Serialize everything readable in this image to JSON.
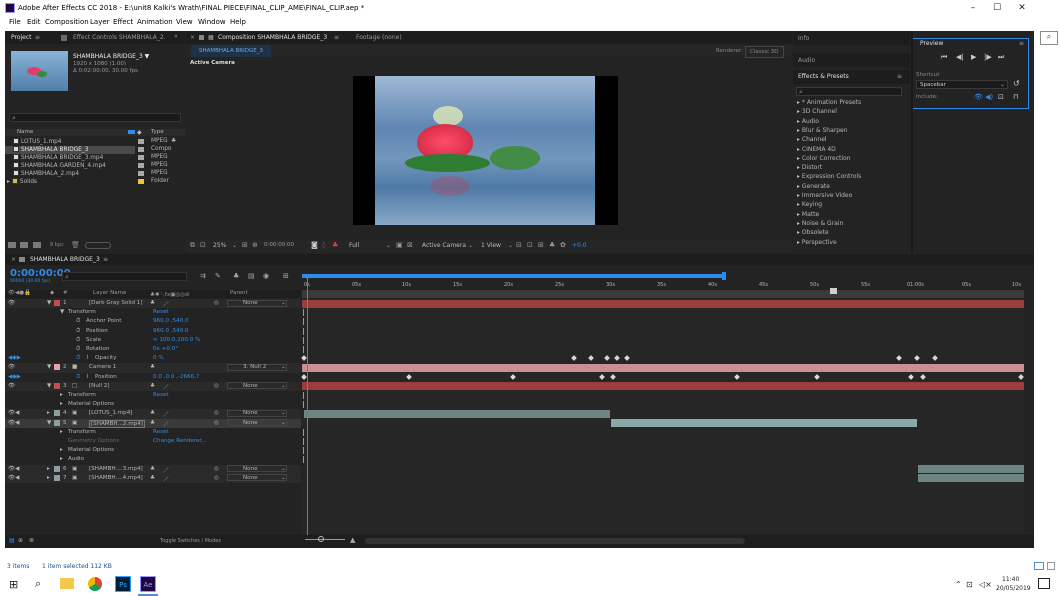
{
  "window": {
    "title": "Adobe After Effects CC 2018 - E:\\unit8 Kalki's Wrath\\FINAL PIECE\\FINAL_CLIP_AME\\FINAL_CLIP.aep *",
    "min": "–",
    "max": "☐",
    "close": "✕"
  },
  "menu": [
    "File",
    "Edit",
    "Composition",
    "Layer",
    "Effect",
    "Animation",
    "View",
    "Window",
    "Help"
  ],
  "project": {
    "tab": "Project",
    "tab_menu": "≡",
    "effect_tab": "Effect Controls SHAMBHALA_2.",
    "more": "»",
    "thumb_name": "SHAMBHALA BRIDGE_3 ▼",
    "thumb_res": "1920 x 1080 (1.00)",
    "thumb_dur": "Δ 0:02:00:00, 30.00 fps",
    "search_icon": "⌕",
    "col_name": "Name",
    "col_type": "Type",
    "items": [
      {
        "name": "LOTUS_1.mp4",
        "type": "MPEG",
        "color": "#a8a8a8",
        "selected": false
      },
      {
        "name": "SHAMBHALA BRIDGE_3",
        "type": "Compo",
        "color": "#a8a8a8",
        "selected": true
      },
      {
        "name": "SHAMBHALA BRIDGE_3.mp4",
        "type": "MPEG",
        "color": "#a8a8a8",
        "selected": false
      },
      {
        "name": "SHAMBHALA GARDEN_4.mp4",
        "type": "MPEG",
        "color": "#a8a8a8",
        "selected": false
      },
      {
        "name": "SHAMBHALA_2.mp4",
        "type": "MPEG",
        "color": "#a8a8a8",
        "selected": false
      },
      {
        "name": "Solids",
        "type": "Folder",
        "color": "#e8c83a",
        "selected": false
      }
    ],
    "bpc": "8 bpc"
  },
  "comp": {
    "tab": "Composition SHAMBHALA BRIDGE_3",
    "tab_menu": "≡",
    "footage": "Footage (none)",
    "subtab": "SHAMBHALA BRIDGE_3",
    "renderer_label": "Renderer:",
    "renderer": "Classic 3D",
    "active_camera": "Active Camera",
    "zoom": "25%",
    "timecode": "0:00:00:00",
    "resolution": "Full",
    "view": "Active Camera",
    "views": "1 View",
    "exposure": "+0.0"
  },
  "right": {
    "info": "Info",
    "audio": "Audio",
    "effects_title": "Effects & Presets",
    "effects_menu": "≡",
    "effects_search": "⌕",
    "effects": [
      "▸ * Animation Presets",
      "▸ 3D Channel",
      "▸ Audio",
      "▸ Blur & Sharpen",
      "▸ Channel",
      "▸ CINEMA 4D",
      "▸ Color Correction",
      "▸ Distort",
      "▸ Expression Controls",
      "▸ Generate",
      "▸ Immersive Video",
      "▸ Keying",
      "▸ Matte",
      "▸ Noise & Grain",
      "▸ Obsolete",
      "▸ Perspective"
    ],
    "preview": "Preview",
    "preview_menu": "≡",
    "shortcut_label": "Shortcut",
    "shortcut": "Spacebar",
    "include_label": "Include:"
  },
  "timeline": {
    "tab": "SHAMBHALA BRIDGE_3",
    "tab_menu": "≡",
    "timecode": "0:00:00:00",
    "fps": "00000 (30.00 fps)",
    "search_icon": "⌕",
    "col_layer": "Layer Name",
    "col_parent": "Parent",
    "ticks": [
      "0s",
      "05s",
      "10s",
      "15s",
      "20s",
      "25s",
      "30s",
      "35s",
      "40s",
      "45s",
      "50s",
      "55s",
      "01:00s",
      "05s",
      "10s"
    ],
    "toggle": "Toggle Switches / Modes",
    "rows": [
      {
        "num": "1",
        "name": "[Dark Gray Solid 1]",
        "val": "",
        "parent": "None",
        "kind": "layer",
        "color": "#c0504f"
      },
      {
        "num": "",
        "name": "Transform",
        "val": "Reset",
        "parent": "",
        "kind": "group"
      },
      {
        "num": "",
        "name": "Anchor Point",
        "val": "960.0 ,540.0",
        "parent": "",
        "kind": "prop"
      },
      {
        "num": "",
        "name": "Position",
        "val": "960.0 ,540.0",
        "parent": "",
        "kind": "prop"
      },
      {
        "num": "",
        "name": "Scale",
        "val": "∞ 100.0,100.0 %",
        "parent": "",
        "kind": "prop"
      },
      {
        "num": "",
        "name": "Rotation",
        "val": "0x +0.0°",
        "parent": "",
        "kind": "prop"
      },
      {
        "num": "",
        "name": "Opacity",
        "val": "0 %",
        "parent": "",
        "kind": "prop"
      },
      {
        "num": "2",
        "name": "Camera 1",
        "val": "",
        "parent": "3. Null 2",
        "kind": "layer",
        "color": "#e8a3a8"
      },
      {
        "num": "",
        "name": "Position",
        "val": "0.0 ,0.0 ,-2666.7",
        "parent": "",
        "kind": "prop"
      },
      {
        "num": "3",
        "name": "[Null 2]",
        "val": "",
        "parent": "None",
        "kind": "layer",
        "color": "#c0504f"
      },
      {
        "num": "",
        "name": "Transform",
        "val": "Reset",
        "parent": "",
        "kind": "group"
      },
      {
        "num": "",
        "name": "Material Options",
        "val": "",
        "parent": "",
        "kind": "group"
      },
      {
        "num": "4",
        "name": "[LOTUS_1.mp4]",
        "val": "",
        "parent": "None",
        "kind": "layer",
        "color": "#8aa0a0"
      },
      {
        "num": "5",
        "name": "[SHAMBH...2.mp4]",
        "val": "",
        "parent": "None",
        "kind": "layer",
        "color": "#8aa0a0"
      },
      {
        "num": "",
        "name": "Transform",
        "val": "Reset",
        "parent": "",
        "kind": "group"
      },
      {
        "num": "",
        "name": "Geometry Options",
        "val": "Change Renderer...",
        "parent": "",
        "kind": "group"
      },
      {
        "num": "",
        "name": "Material Options",
        "val": "",
        "parent": "",
        "kind": "group"
      },
      {
        "num": "",
        "name": "Audio",
        "val": "",
        "parent": "",
        "kind": "group"
      },
      {
        "num": "6",
        "name": "[SHAMBH....3.mp4]",
        "val": "",
        "parent": "None",
        "kind": "layer",
        "color": "#8aa0a0"
      },
      {
        "num": "7",
        "name": "[SHAMBH....4.mp4]",
        "val": "",
        "parent": "None",
        "kind": "layer",
        "color": "#8aa0a0"
      }
    ]
  },
  "status": {
    "items": "3 items",
    "selected": "1 item selected 112 KB"
  },
  "taskbar": {
    "time": "11:40",
    "date": "20/05/2019"
  }
}
